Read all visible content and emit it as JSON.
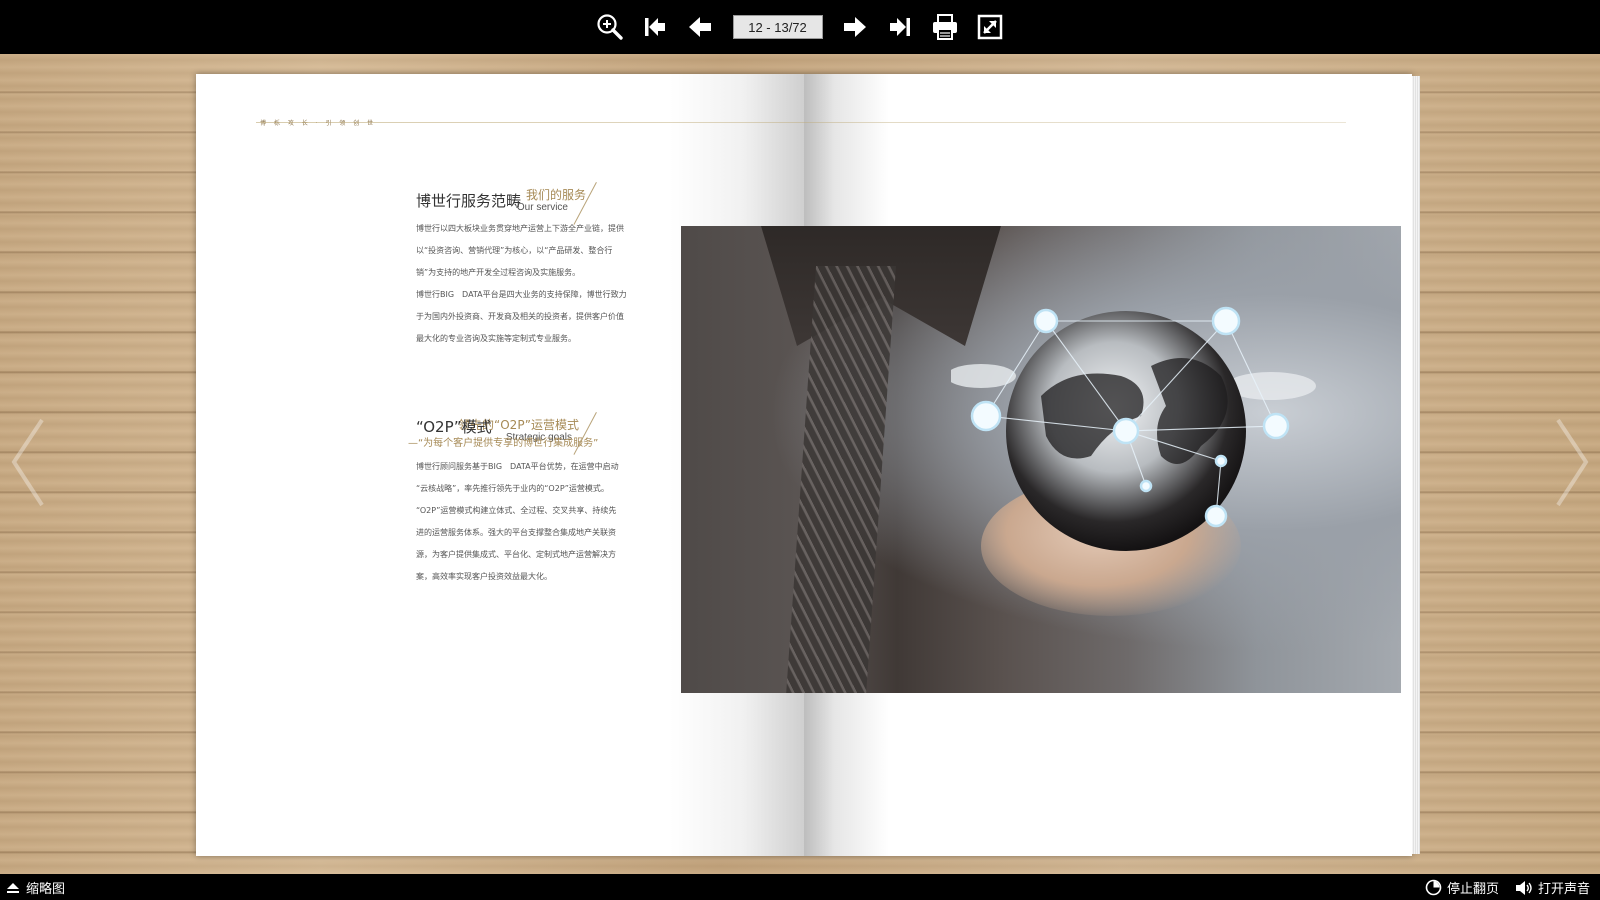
{
  "toolbar": {
    "page_indicator": "12 - 13/72",
    "buttons": [
      {
        "name": "zoom-in-icon"
      },
      {
        "name": "first-page-icon"
      },
      {
        "name": "prev-page-icon"
      },
      {
        "name": "next-page-icon"
      },
      {
        "name": "last-page-icon"
      },
      {
        "name": "print-icon"
      },
      {
        "name": "fullscreen-icon"
      }
    ]
  },
  "bottom_bar": {
    "thumbnails_label": "缩略图",
    "stop_flip_label": "停止翻页",
    "sound_label": "打开声音"
  },
  "page_left": {
    "running_head": "博 栎 攻 长 · 引 领 创 世",
    "section1": {
      "title_cn": "我们的服务",
      "title_en": "Our service",
      "heading": "博世行服务范畴",
      "lines": [
        "博世行以四大板块业务贯穿地产运营上下游全产业链，提供",
        "以“投资咨询、营销代理”为核心，以“产品研发、整合行",
        "销”为支持的地产开发全过程咨询及实施服务。",
        "博世行BIG　DATA平台是四大业务的支持保障，博世行致力",
        "于为国内外投资商、开发商及相关的投资者，提供客户价值",
        "最大化的专业咨询及实施等定制式专业服务。"
      ]
    },
    "section2": {
      "title_cn": "领先的“O2P”运营模式",
      "title_en": "Strategic goals",
      "heading": "“O2P”模式",
      "subheading": "—“为每个客户提供专享的博世行集成服务”",
      "lines": [
        "博世行顾问服务基于BIG　DATA平台优势，在运营中启动",
        "“云核战略”，率先推行领先于业内的“O2P”运营模式。",
        "“O2P”运营模式构建立体式、全过程、交叉共享、持续先",
        "进的运营服务体系。强大的平台支撑整合集成地产关联资",
        "源，为客户提供集成式、平台化、定制式地产运营解决方",
        "案，高效率实现客户投资效益最大化。"
      ]
    }
  },
  "colors": {
    "toolbar_bg": "#000000",
    "accent_gold": "#a68a56",
    "body_text": "#555555"
  }
}
